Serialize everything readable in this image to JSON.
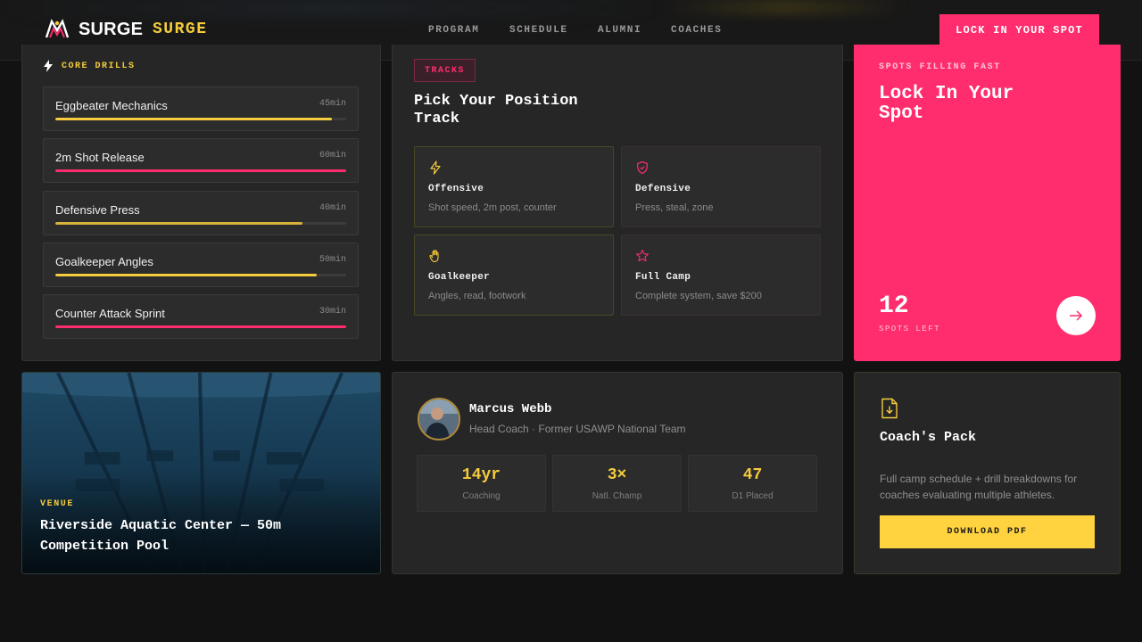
{
  "header": {
    "brand": "SURGE",
    "brand_accent": "SURGE",
    "nav": [
      "PROGRAM",
      "SCHEDULE",
      "ALUMNI",
      "COACHES"
    ],
    "cta_label": "LOCK IN YOUR SPOT",
    "logo_icon": "surge-logo-icon"
  },
  "drills": {
    "label": "CORE DRILLS",
    "icon": "lightning-icon",
    "items": [
      {
        "name": "Eggbeater Mechanics",
        "time": "45min",
        "progress": 0.95,
        "color": "#f5cc3c"
      },
      {
        "name": "2m Shot Release",
        "time": "60min",
        "progress": 1.0,
        "color": "#ff2d6e"
      },
      {
        "name": "Defensive Press",
        "time": "40min",
        "progress": 0.85,
        "color": "#d9b23a"
      },
      {
        "name": "Goalkeeper Angles",
        "time": "50min",
        "progress": 0.9,
        "color": "#f5cc3c"
      },
      {
        "name": "Counter Attack Sprint",
        "time": "30min",
        "progress": 1.0,
        "color": "#ff2d6e"
      }
    ]
  },
  "tracks": {
    "badge": "TRACKS",
    "title": "Pick Your Position Track",
    "items": [
      {
        "name": "Offensive",
        "desc": "Shot speed, 2m post, counter",
        "icon": "lightning-icon"
      },
      {
        "name": "Defensive",
        "desc": "Press, steal, zone",
        "icon": "shield-icon"
      },
      {
        "name": "Goalkeeper",
        "desc": "Angles, read, footwork",
        "icon": "hand-icon"
      },
      {
        "name": "Full Camp",
        "desc": "Complete system, save $200",
        "icon": "star-icon"
      }
    ]
  },
  "spots": {
    "label": "SPOTS FILLING FAST",
    "title": "Lock In Your Spot",
    "count": "12",
    "count_label": "SPOTS LEFT",
    "arrow_icon": "arrow-right-icon"
  },
  "venue": {
    "label": "VENUE",
    "title": "Riverside Aquatic Center — 50m Competition Pool"
  },
  "coach": {
    "name": "Marcus Webb",
    "role": "Head Coach · Former USAWP National Team",
    "stats": [
      {
        "value": "14yr",
        "label": "Coaching"
      },
      {
        "value": "3×",
        "label": "Natl. Champ"
      },
      {
        "value": "47",
        "label": "D1 Placed"
      }
    ]
  },
  "pack": {
    "icon": "download-file-icon",
    "title": "Coach's Pack",
    "desc": "Full camp schedule + drill breakdowns for coaches evaluating multiple athletes.",
    "button": "DOWNLOAD PDF"
  },
  "colors": {
    "accent_pink": "#ff2d6e",
    "accent_yellow": "#f5cc3c",
    "background": "#121212",
    "panel": "#262626"
  }
}
